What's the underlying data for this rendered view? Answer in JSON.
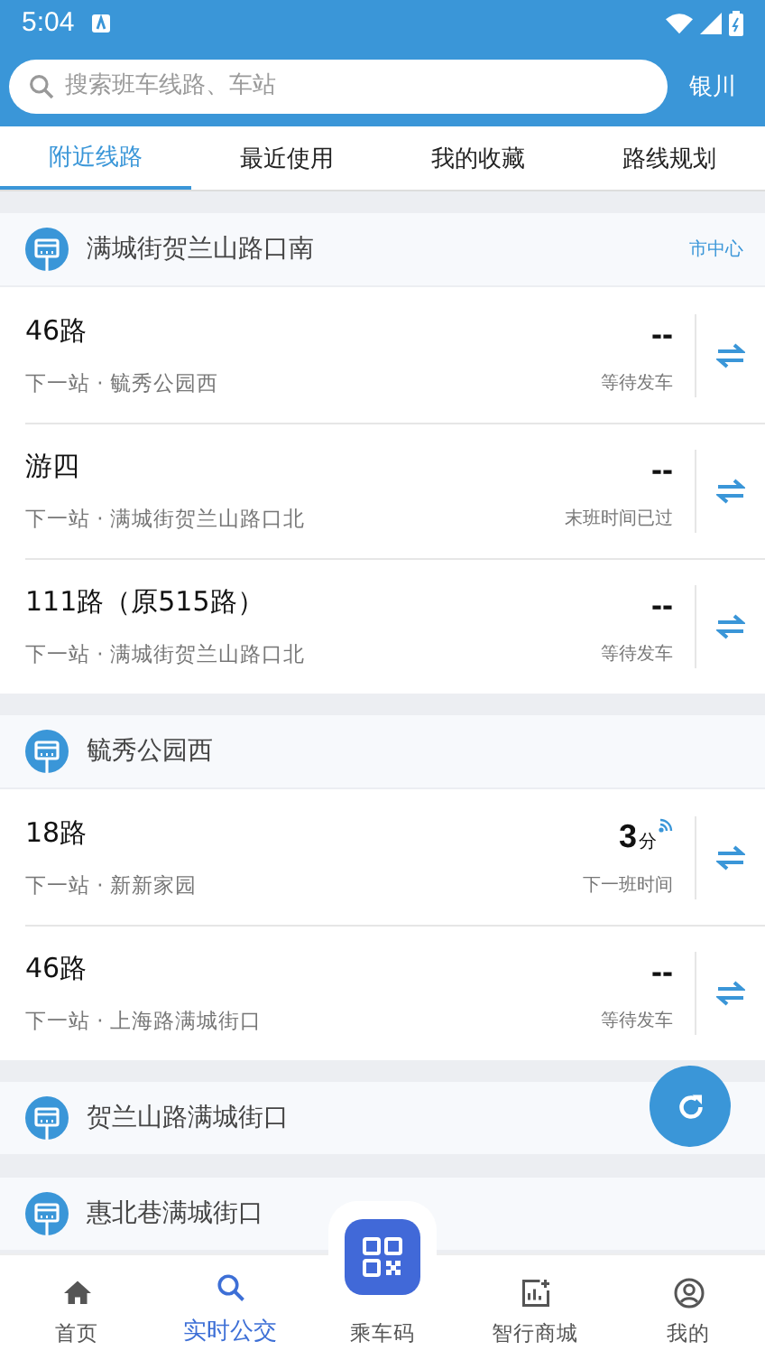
{
  "status_bar": {
    "time": "5:04"
  },
  "search": {
    "placeholder": "搜索班车线路、车站",
    "city": "银川"
  },
  "tabs": [
    {
      "label": "附近线路",
      "selected": true
    },
    {
      "label": "最近使用",
      "selected": false
    },
    {
      "label": "我的收藏",
      "selected": false
    },
    {
      "label": "路线规划",
      "selected": false
    }
  ],
  "stations": [
    {
      "name": "满城街贺兰山路口南",
      "tag": "市中心",
      "routes": [
        {
          "name": "46路",
          "next_stop": "下一站 · 毓秀公园西",
          "eta": "--",
          "status": "等待发车",
          "realtime": false
        },
        {
          "name": "游四",
          "next_stop": "下一站 · 满城街贺兰山路口北",
          "eta": "--",
          "status": "末班时间已过",
          "realtime": false
        },
        {
          "name": "111路（原515路）",
          "next_stop": "下一站 · 满城街贺兰山路口北",
          "eta": "--",
          "status": "等待发车",
          "realtime": false
        }
      ]
    },
    {
      "name": "毓秀公园西",
      "routes": [
        {
          "name": "18路",
          "next_stop": "下一站 · 新新家园",
          "eta": "3",
          "eta_unit": "分",
          "status": "下一班时间",
          "realtime": true
        },
        {
          "name": "46路",
          "next_stop": "下一站 · 上海路满城街口",
          "eta": "--",
          "status": "等待发车",
          "realtime": false
        }
      ]
    },
    {
      "name": "贺兰山路满城街口"
    },
    {
      "name": "惠北巷满城街口"
    }
  ],
  "nav": [
    {
      "label": "首页",
      "kind": "home",
      "selected": false
    },
    {
      "label": "实时公交",
      "kind": "search",
      "selected": true
    },
    {
      "label": "乘车码",
      "kind": "qr",
      "selected": false
    },
    {
      "label": "智行商城",
      "kind": "mall",
      "selected": false
    },
    {
      "label": "我的",
      "kind": "profile",
      "selected": false
    }
  ]
}
